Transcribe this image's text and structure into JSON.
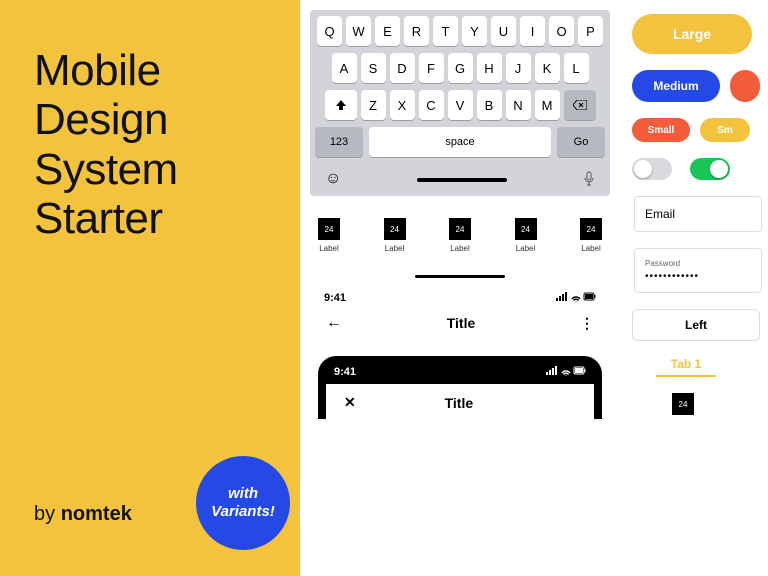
{
  "left": {
    "headline_l1": "Mobile",
    "headline_l2": "Design",
    "headline_l3": "System",
    "headline_l4": "Starter",
    "by": "by ",
    "brand": "nomtek",
    "badge_l1": "with",
    "badge_l2": "Variants!"
  },
  "keyboard": {
    "row1": [
      "Q",
      "W",
      "E",
      "R",
      "T",
      "Y",
      "U",
      "I",
      "O",
      "P"
    ],
    "row2": [
      "A",
      "S",
      "D",
      "F",
      "G",
      "H",
      "J",
      "K",
      "L"
    ],
    "row3": [
      "Z",
      "X",
      "C",
      "V",
      "B",
      "N",
      "M"
    ],
    "k123": "123",
    "space": "space",
    "go": "Go"
  },
  "iconrow": {
    "box": "24",
    "label": "Label"
  },
  "nav": {
    "time": "9:41",
    "title": "Title"
  },
  "right": {
    "large": "Large",
    "medium": "Medium",
    "small": "Small",
    "small2": "Sm",
    "email": "Email",
    "pwlabel": "Password",
    "pwdots": "••••••••••••",
    "leftbtn": "Left",
    "tab1": "Tab 1",
    "icon24": "24"
  }
}
